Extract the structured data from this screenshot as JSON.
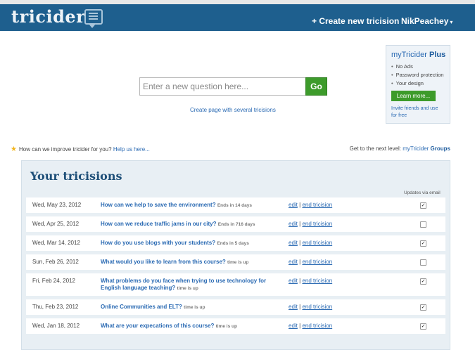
{
  "header": {
    "logo": "tricider",
    "create_link": "+ Create new tricision",
    "user_menu": "NikPeachey",
    "user_caret": "▾"
  },
  "search": {
    "placeholder": "Enter a new question here...",
    "go_label": "Go",
    "multi_link": "Create page with several tricisions"
  },
  "plus_box": {
    "title_prefix": "myTricider",
    "title_strong": "Plus",
    "features": [
      "No Ads",
      "Password protection",
      "Your design"
    ],
    "learn_more": "Learn more...",
    "invite": "Invite friends and use for free"
  },
  "feedback": {
    "text": "How can we improve tricider for you?",
    "link": "Help us here..."
  },
  "next_level": {
    "text": "Get to the next level:",
    "link_prefix": "myTricider",
    "link_strong": "Groups"
  },
  "tricisions": {
    "title": "Your tricisions",
    "updates_header": "Updates via email",
    "edit_label": "edit",
    "separator": "|",
    "end_label": "end tricision",
    "rows": [
      {
        "date": "Wed, May 23, 2012",
        "question": "How can we help to save the environment?",
        "status": "Ends in 14 days",
        "email_updates": true
      },
      {
        "date": "Wed, Apr 25, 2012",
        "question": "How can we reduce traffic jams in our city?",
        "status": "Ends in 716 days",
        "email_updates": false
      },
      {
        "date": "Wed, Mar 14, 2012",
        "question": "How do you use blogs with your students?",
        "status": "Ends in 5 days",
        "email_updates": true
      },
      {
        "date": "Sun, Feb 26, 2012",
        "question": "What would you like to learn from this course?",
        "status": "time is up",
        "email_updates": false
      },
      {
        "date": "Fri, Feb 24, 2012",
        "question": "What problems do you face when trying to use technology for English language teaching?",
        "status": "time is up",
        "email_updates": true
      },
      {
        "date": "Thu, Feb 23, 2012",
        "question": "Online Communities and ELT?",
        "status": "time is up",
        "email_updates": true
      },
      {
        "date": "Wed, Jan 18, 2012",
        "question": "What are your expecations of this course?",
        "status": "time is up",
        "email_updates": true
      }
    ]
  },
  "colors": {
    "header_bg": "#1e5f8e",
    "accent_green": "#3d9b2b",
    "link_blue": "#2a6ab3"
  }
}
